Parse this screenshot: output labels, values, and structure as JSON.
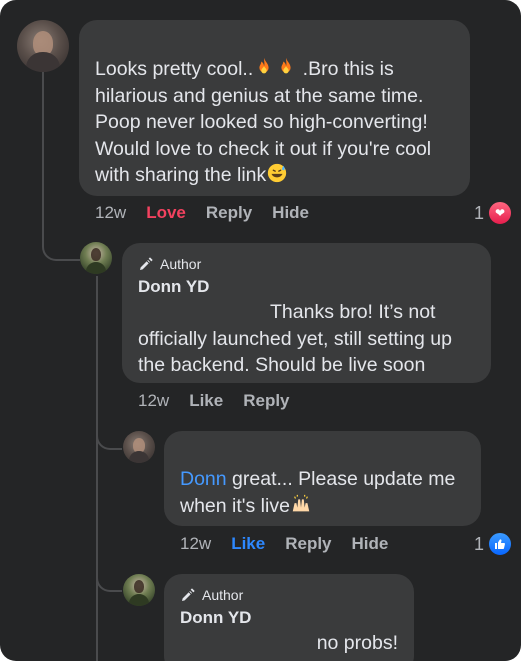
{
  "comments": [
    {
      "id": "c1",
      "author_badge": "",
      "author_name": "",
      "text_parts": [
        "Looks pretty cool..",
        " .Bro this is\nhilarious and genius at the same time.\nPoop never looked so high-converting!\nWould love to check it out if you're cool\nwith sharing the link"
      ],
      "actions": {
        "time": "12w",
        "reaction": "Love",
        "reply": "Reply",
        "hide": "Hide"
      },
      "reaction_count": "1",
      "reaction_icon": "heart-icon"
    },
    {
      "id": "c2",
      "author_badge": "Author",
      "author_name": "Donn YD",
      "text": "Thanks bro! It’s not\nofficially launched yet, still setting up\nthe backend. Should be live soon",
      "actions": {
        "time": "12w",
        "like": "Like",
        "reply": "Reply"
      }
    },
    {
      "id": "c3",
      "mention": "Donn",
      "text": " great... Please update me\nwhen it's live",
      "actions": {
        "time": "12w",
        "like": "Like",
        "reply": "Reply",
        "hide": "Hide"
      },
      "reaction_count": "1",
      "reaction_icon": "thumbs-up-icon"
    },
    {
      "id": "c4",
      "author_badge": "Author",
      "author_name": "Donn YD",
      "text": "no probs!"
    }
  ],
  "colors": {
    "background": "#242526",
    "bubble": "#3a3b3c",
    "text": "#e4e6eb",
    "muted": "#b0b3b8",
    "love": "#f3425f",
    "like": "#2d88ff",
    "mention": "#4599ff"
  }
}
